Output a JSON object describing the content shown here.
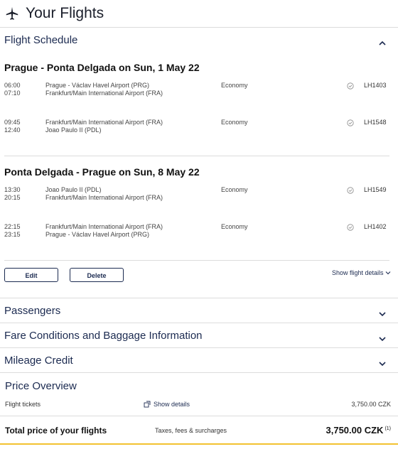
{
  "header": {
    "title": "Your Flights",
    "icon": "airplane-icon"
  },
  "schedule": {
    "title": "Flight Schedule",
    "trips": [
      {
        "title": "Prague - Ponta Delgada on Sun, 1 May 22",
        "flights": [
          {
            "dep": "06:00",
            "arr": "07:10",
            "from": "Prague - Václav Havel Airport (PRG)",
            "to": "Frankfurt/Main International Airport (FRA)",
            "cabin": "Economy",
            "number": "LH1403"
          },
          {
            "dep": "09:45",
            "arr": "12:40",
            "from": "Frankfurt/Main International Airport (FRA)",
            "to": "Joao Paulo II (PDL)",
            "cabin": "Economy",
            "number": "LH1548"
          }
        ]
      },
      {
        "title": "Ponta Delgada - Prague on Sun, 8 May 22",
        "flights": [
          {
            "dep": "13:30",
            "arr": "20:15",
            "from": "Joao Paulo II (PDL)",
            "to": "Frankfurt/Main International Airport (FRA)",
            "cabin": "Economy",
            "number": "LH1549"
          },
          {
            "dep": "22:15",
            "arr": "23:15",
            "from": "Frankfurt/Main International Airport (FRA)",
            "to": "Prague - Václav Havel Airport (PRG)",
            "cabin": "Economy",
            "number": "LH1402"
          }
        ]
      }
    ],
    "edit_label": "Edit",
    "delete_label": "Delete",
    "show_flight_details": "Show flight details"
  },
  "sections": {
    "passengers": "Passengers",
    "fare": "Fare Conditions and Baggage Information",
    "mileage": "Mileage Credit"
  },
  "price": {
    "title": "Price Overview",
    "tickets_label": "Flight tickets",
    "show_details": "Show details",
    "tickets_amount": "3,750.00 CZK",
    "total_label": "Total price of your flights",
    "taxes_note": "Taxes, fees & surcharges",
    "total_amount": "3,750.00 CZK",
    "footnote": "(1)"
  },
  "colors": {
    "accent": "#1b2a50",
    "underline": "#f2c230",
    "divider": "#dcdcdc"
  }
}
